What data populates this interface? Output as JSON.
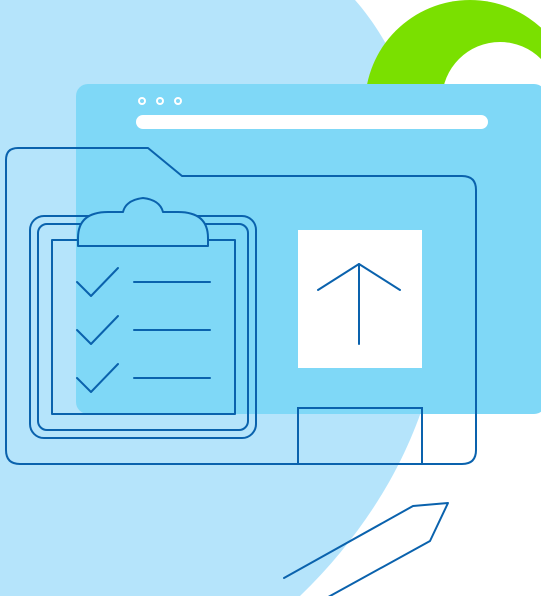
{
  "illustration": {
    "icons": [
      "browser-window-icon",
      "folder-icon",
      "clipboard-checklist-icon",
      "upload-arrow-icon",
      "pencil-icon"
    ],
    "checklist_items": 3,
    "colors": {
      "background": "#ffffff",
      "blob_light_blue": "#b5e4fb",
      "window_blue": "#7fd8f7",
      "accent_green": "#7ae000",
      "line_blue": "#0a62ad",
      "white": "#ffffff"
    }
  }
}
